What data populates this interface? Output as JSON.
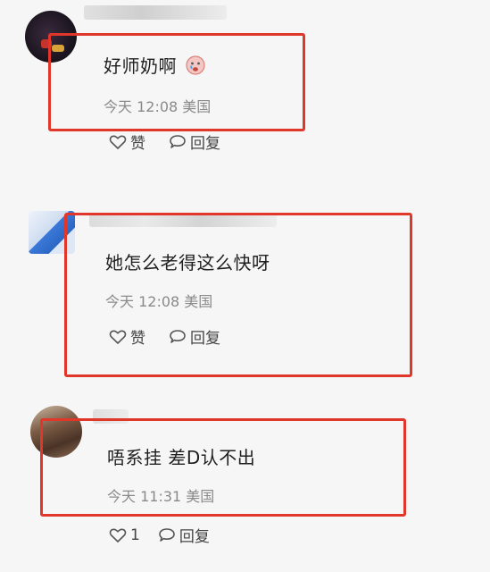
{
  "comments": [
    {
      "text": "好师奶啊",
      "emoji": "sad-face-emoji",
      "time": "今天 12:08",
      "location": "美国",
      "like_label": "赞",
      "reply_label": "回复"
    },
    {
      "text": "她怎么老得这么快呀",
      "time": "今天 12:08",
      "location": "美国",
      "like_label": "赞",
      "reply_label": "回复"
    },
    {
      "text": "唔系挂 差D认不出",
      "time": "今天 11:31",
      "location": "美国",
      "like_label": "1",
      "reply_label": "回复"
    }
  ],
  "colors": {
    "highlight": "#e0372a",
    "meta": "#8a8a8a"
  }
}
